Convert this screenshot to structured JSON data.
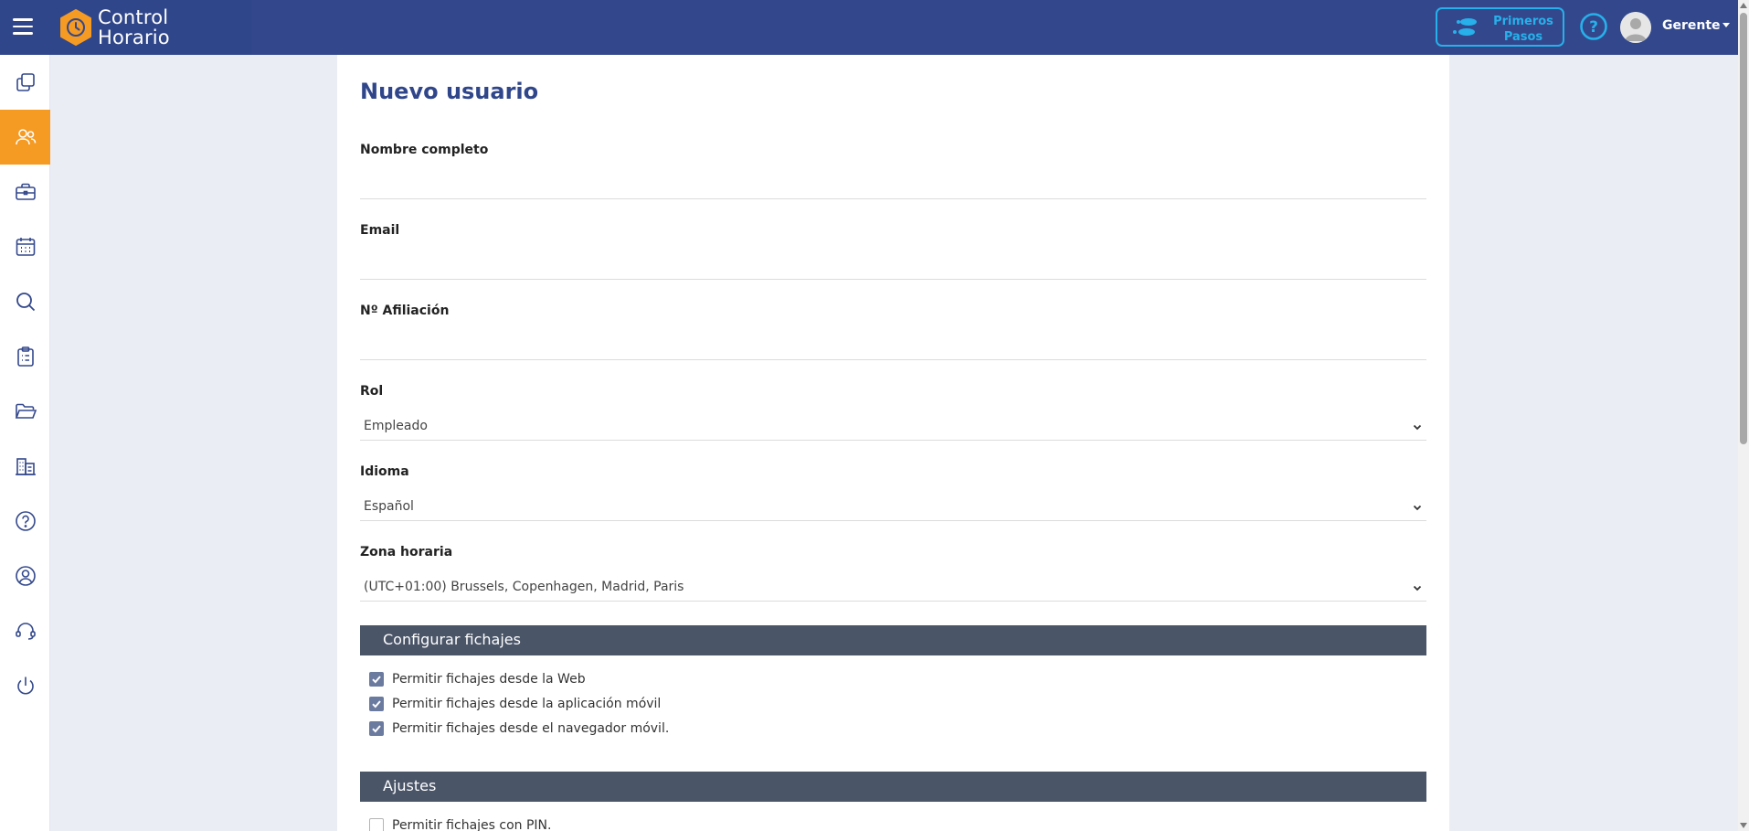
{
  "app": {
    "name_line1": "Control",
    "name_line2": "Horario"
  },
  "header": {
    "primeros_pasos": "Primeros Pasos",
    "user_name": "Gerente"
  },
  "sidebar": {
    "items": [
      {
        "icon": "copy-icon",
        "active": false
      },
      {
        "icon": "users-icon",
        "active": true
      },
      {
        "icon": "briefcase-icon",
        "active": false
      },
      {
        "icon": "calendar-icon",
        "active": false
      },
      {
        "icon": "search-icon",
        "active": false
      },
      {
        "icon": "clipboard-icon",
        "active": false
      },
      {
        "icon": "folder-icon",
        "active": false
      },
      {
        "icon": "building-icon",
        "active": false
      },
      {
        "icon": "help-icon",
        "active": false
      },
      {
        "icon": "user-circle-icon",
        "active": false
      },
      {
        "icon": "headset-icon",
        "active": false
      },
      {
        "icon": "power-icon",
        "active": false
      }
    ]
  },
  "form": {
    "title": "Nuevo usuario",
    "fields": {
      "nombre": {
        "label": "Nombre completo",
        "value": ""
      },
      "email": {
        "label": "Email",
        "value": ""
      },
      "afiliacion": {
        "label": "Nº Afiliación",
        "value": ""
      }
    },
    "selects": {
      "rol": {
        "label": "Rol",
        "value": "Empleado"
      },
      "idioma": {
        "label": "Idioma",
        "value": "Español"
      },
      "zona": {
        "label": "Zona horaria",
        "value": "(UTC+01:00) Brussels, Copenhagen, Madrid, Paris"
      }
    },
    "section_fichajes": {
      "title": "Configurar fichajes",
      "options": [
        {
          "label": "Permitir fichajes desde la Web",
          "checked": true
        },
        {
          "label": "Permitir fichajes desde la aplicación móvil",
          "checked": true
        },
        {
          "label": "Permitir fichajes desde el navegador móvil.",
          "checked": true
        }
      ]
    },
    "section_ajustes": {
      "title": "Ajustes",
      "options": [
        {
          "label": "Permitir fichajes con PIN.",
          "checked": false
        }
      ]
    }
  },
  "colors": {
    "header": "#33488c",
    "accent": "#f59a23",
    "section": "#4a5568",
    "title": "#30468a",
    "link": "#27b0ea"
  }
}
